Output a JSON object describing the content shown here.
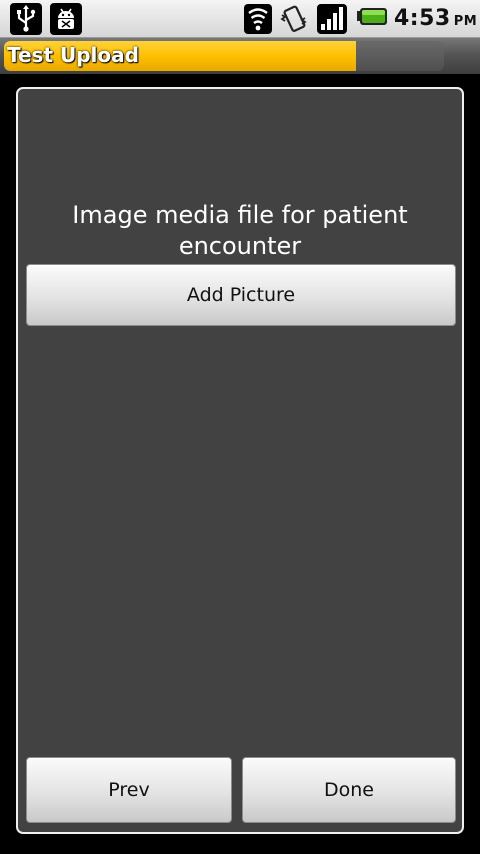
{
  "status_bar": {
    "time": "4:53",
    "ampm": "PM",
    "left_icons": [
      "usb-icon",
      "android-debug-icon"
    ],
    "right_icons": [
      "wifi-icon",
      "vibrate-icon",
      "signal-icon",
      "battery-icon"
    ],
    "battery_color": "#4caf1a"
  },
  "title_bar": {
    "title": "Test Upload",
    "progress": 0.8,
    "progress_color": "#ffc000"
  },
  "form": {
    "prompt": "Image media file for patient encounter",
    "add_picture_label": "Add Picture",
    "prev_label": "Prev",
    "done_label": "Done"
  }
}
